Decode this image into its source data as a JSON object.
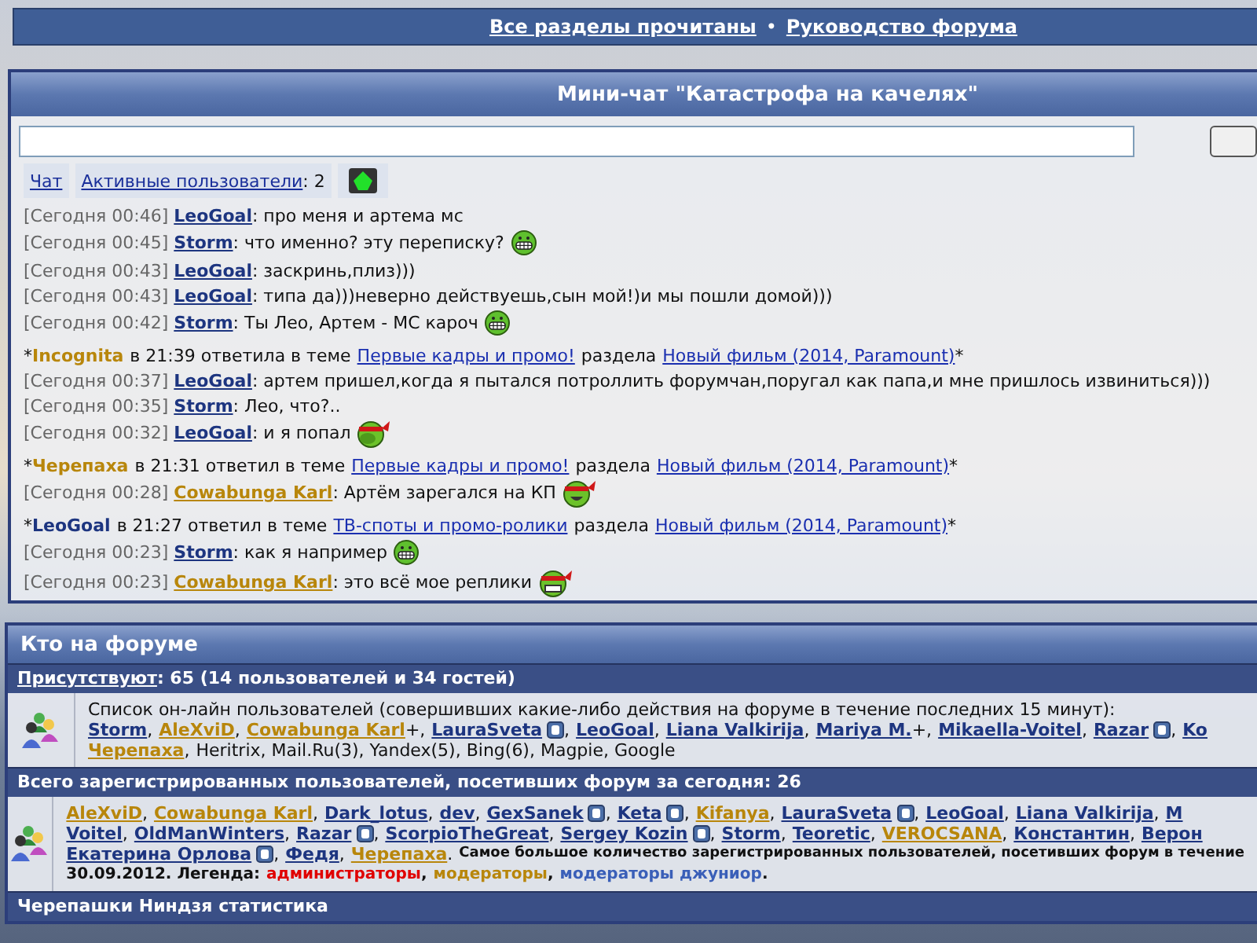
{
  "top_links": [
    {
      "label": "Все разделы прочитаны"
    },
    {
      "label": "Руководство форума"
    }
  ],
  "top_separator": "•",
  "minichat": {
    "title": "Мини-чат \"Катастрофа на качелях\"",
    "tabs": [
      {
        "label": "Чат"
      },
      {
        "label": "Активные пользователи",
        "after": ": 2"
      }
    ],
    "lines": [
      {
        "kind": "message",
        "time": "[Сегодня 00:46]",
        "user": {
          "name": "LeoGoal",
          "kind": "member"
        },
        "text": ": про меня и артема мс"
      },
      {
        "kind": "message",
        "time": "[Сегодня 00:45]",
        "user": {
          "name": "Storm",
          "kind": "member"
        },
        "text": ": что именно? эту переписку?",
        "emoticon": {
          "kind": "grin"
        }
      },
      {
        "kind": "message",
        "time": "[Сегодня 00:43]",
        "user": {
          "name": "LeoGoal",
          "kind": "member"
        },
        "text": ": заскринь,плиз)))"
      },
      {
        "kind": "message",
        "time": "[Сегодня 00:43]",
        "user": {
          "name": "LeoGoal",
          "kind": "member"
        },
        "text": ": типа да)))неверно действуешь,сын мой!)и мы пошли домой)))"
      },
      {
        "kind": "message",
        "time": "[Сегодня 00:42]",
        "user": {
          "name": "Storm",
          "kind": "member"
        },
        "text": ": Ты Лео, Артем - МС кароч",
        "emoticon": {
          "kind": "grin"
        }
      },
      {
        "kind": "notice",
        "lead": "*",
        "user": {
          "name": "Incognita",
          "kind": "moderator"
        },
        "text": "в 21:39 ответила в теме",
        "topic": "Первые кадры и промо!",
        "middle": "раздела",
        "section": "Новый фильм (2014, Paramount)",
        "trail": "*"
      },
      {
        "kind": "message",
        "time": "[Сегодня 00:37]",
        "user": {
          "name": "LeoGoal",
          "kind": "member"
        },
        "text": ": артем пришел,когда я пытался потроллить форумчан,поругал как папа,и мне пришлось извиниться)))"
      },
      {
        "kind": "message",
        "time": "[Сегодня 00:35]",
        "user": {
          "name": "Storm",
          "kind": "member"
        },
        "text": ": Лео, что?.."
      },
      {
        "kind": "message",
        "time": "[Сегодня 00:32]",
        "user": {
          "name": "LeoGoal",
          "kind": "member"
        },
        "text": ": и я попал",
        "emoticon": {
          "kind": "ninja-facepalm"
        }
      },
      {
        "kind": "notice",
        "lead": "*",
        "user": {
          "name": "Черепаха",
          "kind": "moderator"
        },
        "text": "в 21:31 ответил в теме",
        "topic": "Первые кадры и промо!",
        "middle": "раздела",
        "section": "Новый фильм (2014, Paramount)",
        "trail": "*"
      },
      {
        "kind": "message",
        "time": "[Сегодня 00:28]",
        "user": {
          "name": "Cowabunga Karl",
          "kind": "moderator"
        },
        "text": ": Артём зарегался на КП",
        "emoticon": {
          "kind": "ninja-smile"
        }
      },
      {
        "kind": "notice",
        "lead": "*",
        "user": {
          "name": "LeoGoal",
          "kind": "member"
        },
        "text": "в 21:27 ответил в теме",
        "topic": "ТВ-споты и промо-ролики",
        "middle": "раздела",
        "section": "Новый фильм (2014, Paramount)",
        "trail": "*"
      },
      {
        "kind": "message",
        "time": "[Сегодня 00:23]",
        "user": {
          "name": "Storm",
          "kind": "member"
        },
        "text": ": как я например",
        "emoticon": {
          "kind": "grin"
        }
      },
      {
        "kind": "message",
        "time": "[Сегодня 00:23]",
        "user": {
          "name": "Cowabunga Karl",
          "kind": "moderator"
        },
        "text": ": это всё мое реплики",
        "emoticon": {
          "kind": "ninja-grin"
        }
      }
    ]
  },
  "online": {
    "title": "Кто на форуме",
    "present_label": "Присутствуют",
    "present_text": ": 65 (14 пользователей и 34 гостей)",
    "intro": "Список он-лайн пользователей (совершивших какие-либо действия на форуме в течение последних 15 минут):",
    "lines": [
      {
        "users": [
          {
            "name": "Storm",
            "kind": "member",
            "suffix": ","
          },
          {
            "name": "AleXviD",
            "kind": "moderator",
            "suffix": ","
          },
          {
            "name": "Cowabunga Karl",
            "kind": "moderator",
            "suffix": "+,"
          },
          {
            "name": "LauraSveta",
            "kind": "member",
            "badge": true,
            "suffix": ","
          },
          {
            "name": "LeoGoal",
            "kind": "member",
            "suffix": ","
          },
          {
            "name": "Liana Valkirija",
            "kind": "member",
            "suffix": ","
          },
          {
            "name": "Mariya M.",
            "kind": "member",
            "suffix": "+,"
          },
          {
            "name": "Mikaella-Voitel",
            "kind": "member",
            "suffix": ","
          },
          {
            "name": "Razar",
            "kind": "member",
            "badge": true,
            "suffix": ","
          },
          {
            "name": "Ko",
            "kind": "member"
          }
        ]
      },
      {
        "users": [
          {
            "name": "Черепаха",
            "kind": "moderator",
            "suffix": ","
          }
        ],
        "tail": "Heritrix, Mail.Ru(3), Yandex(5), Bing(6), Magpie, Google"
      }
    ]
  },
  "today": {
    "title": "Всего зарегистрированных пользователей, посетивших форум за сегодня: 26",
    "lines": [
      {
        "users": [
          {
            "name": "AleXviD",
            "kind": "moderator",
            "suffix": ","
          },
          {
            "name": "Cowabunga Karl",
            "kind": "moderator",
            "suffix": ","
          },
          {
            "name": "Dark_lotus",
            "kind": "member",
            "suffix": ","
          },
          {
            "name": "dev",
            "kind": "member",
            "suffix": ","
          },
          {
            "name": "GexSanek",
            "kind": "member",
            "badge": true,
            "suffix": ","
          },
          {
            "name": "Keta",
            "kind": "member",
            "badge": true,
            "suffix": ","
          },
          {
            "name": "Kifanya",
            "kind": "moderator",
            "suffix": ","
          },
          {
            "name": "LauraSveta",
            "kind": "member",
            "badge": true,
            "suffix": ","
          },
          {
            "name": "LeoGoal",
            "kind": "member",
            "suffix": ","
          },
          {
            "name": "Liana Valkirija",
            "kind": "member",
            "suffix": ","
          },
          {
            "name": "M",
            "kind": "member"
          }
        ]
      },
      {
        "users": [
          {
            "name": "Voitel",
            "kind": "member",
            "suffix": ","
          },
          {
            "name": "OldManWinters",
            "kind": "member",
            "suffix": ","
          },
          {
            "name": "Razar",
            "kind": "member",
            "badge": true,
            "suffix": ","
          },
          {
            "name": "ScorpioTheGreat",
            "kind": "member",
            "suffix": ","
          },
          {
            "name": "Sergey Kozin",
            "kind": "member",
            "badge": true,
            "suffix": ","
          },
          {
            "name": "Storm",
            "kind": "member",
            "suffix": ","
          },
          {
            "name": "Teoretic",
            "kind": "member",
            "suffix": ","
          },
          {
            "name": "VEROCSANA",
            "kind": "moderator",
            "suffix": ","
          },
          {
            "name": "Константин",
            "kind": "member",
            "suffix": ","
          },
          {
            "name": "Верон",
            "kind": "member"
          }
        ]
      },
      {
        "users": [
          {
            "name": "Екатерина Орлова",
            "kind": "member",
            "badge": true,
            "suffix": ","
          },
          {
            "name": "Федя",
            "kind": "member",
            "suffix": ","
          },
          {
            "name": "Черепаха",
            "kind": "moderator",
            "suffix": "."
          }
        ],
        "tail": "Самое большое количество зарегистрированных пользователей, посетивших форум в течение"
      }
    ],
    "legend_text": "30.09.2012. Легенда:",
    "legend": [
      {
        "label": "администраторы",
        "color": "#e00000",
        "suffix": ","
      },
      {
        "label": "модераторы",
        "color": "#b8860b",
        "suffix": ","
      },
      {
        "label": "модераторы джуниор",
        "color": "#3a5fb8",
        "suffix": "."
      }
    ]
  },
  "stats_title": "Черепашки Ниндзя статистика"
}
